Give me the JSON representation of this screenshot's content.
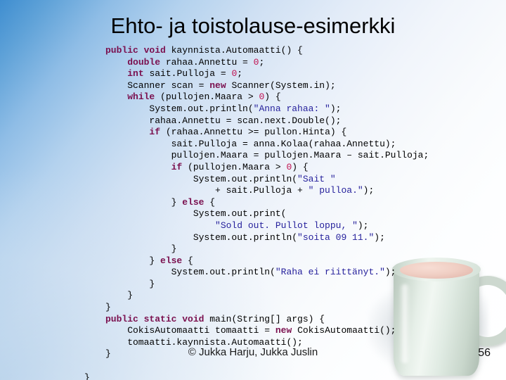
{
  "slide": {
    "title": "Ehto- ja toistolause-esimerkki",
    "page_number": "56",
    "credit": "© Jukka Harju, Jukka Juslin",
    "background_start": "#3f8ed0",
    "background_end": "#ffffff"
  },
  "syntax_colors": {
    "keyword": "#7a0f4e",
    "number": "#c01050",
    "string": "#26219c",
    "plain": "#000000"
  },
  "image": {
    "name": "coffee-mug-photo",
    "description": "pale green ceramic mug with pink-beige drink",
    "mug_color": "#ccd9cf",
    "liquid_color": "#f0cfc4"
  },
  "code": {
    "language": "Java",
    "lines": [
      [
        {
          "t": "kw",
          "s": "public void "
        },
        {
          "t": "pl",
          "s": "kaynnista.Automaatti() {"
        }
      ],
      [
        {
          "t": "pl",
          "s": "    "
        },
        {
          "t": "kw",
          "s": "double "
        },
        {
          "t": "pl",
          "s": "rahaa.Annettu = "
        },
        {
          "t": "num",
          "s": "0"
        },
        {
          "t": "pl",
          "s": ";"
        }
      ],
      [
        {
          "t": "pl",
          "s": "    "
        },
        {
          "t": "kw",
          "s": "int "
        },
        {
          "t": "pl",
          "s": "sait.Pulloja = "
        },
        {
          "t": "num",
          "s": "0"
        },
        {
          "t": "pl",
          "s": ";"
        }
      ],
      [
        {
          "t": "pl",
          "s": "    Scanner scan = "
        },
        {
          "t": "kw",
          "s": "new "
        },
        {
          "t": "pl",
          "s": "Scanner(System.in);"
        }
      ],
      [
        {
          "t": "pl",
          "s": "    "
        },
        {
          "t": "kw",
          "s": "while "
        },
        {
          "t": "pl",
          "s": "(pullojen.Maara > "
        },
        {
          "t": "num",
          "s": "0"
        },
        {
          "t": "pl",
          "s": ") {"
        }
      ],
      [
        {
          "t": "pl",
          "s": "        System.out.println("
        },
        {
          "t": "str",
          "s": "\"Anna rahaa: \""
        },
        {
          "t": "pl",
          "s": ");"
        }
      ],
      [
        {
          "t": "pl",
          "s": "        rahaa.Annettu = scan.next.Double();"
        }
      ],
      [
        {
          "t": "pl",
          "s": "        "
        },
        {
          "t": "kw",
          "s": "if "
        },
        {
          "t": "pl",
          "s": "(rahaa.Annettu >= pullon.Hinta) {"
        }
      ],
      [
        {
          "t": "pl",
          "s": "            sait.Pulloja = anna.Kolaa(rahaa.Annettu);"
        }
      ],
      [
        {
          "t": "pl",
          "s": "            pullojen.Maara = pullojen.Maara – sait.Pulloja;"
        }
      ],
      [
        {
          "t": "pl",
          "s": "            "
        },
        {
          "t": "kw",
          "s": "if "
        },
        {
          "t": "pl",
          "s": "(pullojen.Maara > "
        },
        {
          "t": "num",
          "s": "0"
        },
        {
          "t": "pl",
          "s": ") {"
        }
      ],
      [
        {
          "t": "pl",
          "s": "                System.out.println("
        },
        {
          "t": "str",
          "s": "\"Sait \""
        }
      ],
      [
        {
          "t": "pl",
          "s": "                    + sait.Pulloja + "
        },
        {
          "t": "str",
          "s": "\" pulloa.\""
        },
        {
          "t": "pl",
          "s": ");"
        }
      ],
      [
        {
          "t": "pl",
          "s": "            } "
        },
        {
          "t": "kw",
          "s": "else "
        },
        {
          "t": "pl",
          "s": "{"
        }
      ],
      [
        {
          "t": "pl",
          "s": "                System.out.print("
        }
      ],
      [
        {
          "t": "pl",
          "s": "                    "
        },
        {
          "t": "str",
          "s": "\"Sold out. Pullot loppu, \""
        },
        {
          "t": "pl",
          "s": ");"
        }
      ],
      [
        {
          "t": "pl",
          "s": "                System.out.println("
        },
        {
          "t": "str",
          "s": "\"soita 09 11.\""
        },
        {
          "t": "pl",
          "s": ");"
        }
      ],
      [
        {
          "t": "pl",
          "s": "            }"
        }
      ],
      [
        {
          "t": "pl",
          "s": "        } "
        },
        {
          "t": "kw",
          "s": "else "
        },
        {
          "t": "pl",
          "s": "{"
        }
      ],
      [
        {
          "t": "pl",
          "s": "            System.out.println("
        },
        {
          "t": "str",
          "s": "\"Raha ei riittänyt.\""
        },
        {
          "t": "pl",
          "s": ");"
        }
      ],
      [
        {
          "t": "pl",
          "s": "        }"
        }
      ],
      [
        {
          "t": "pl",
          "s": "    }"
        }
      ],
      [
        {
          "t": "pl",
          "s": "}"
        }
      ],
      [
        {
          "t": "kw",
          "s": "public static void "
        },
        {
          "t": "pl",
          "s": "main(String[] args) {"
        }
      ],
      [
        {
          "t": "pl",
          "s": "    CokisAutomaatti tomaatti = "
        },
        {
          "t": "kw",
          "s": "new "
        },
        {
          "t": "pl",
          "s": "CokisAutomaatti();"
        }
      ],
      [
        {
          "t": "pl",
          "s": "    tomaatti.kaynnista.Automaatti();"
        }
      ],
      [
        {
          "t": "pl",
          "s": "}"
        }
      ],
      [
        {
          "t": "pl",
          "s": ""
        }
      ],
      [
        {
          "t": "pl",
          "s": "}",
          "outdent": true
        }
      ]
    ]
  }
}
